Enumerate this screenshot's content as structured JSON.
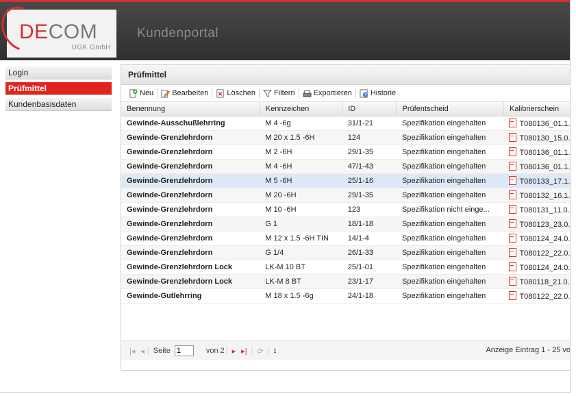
{
  "header": {
    "logo": {
      "brand_de": "DE",
      "brand_com": "COM",
      "sub": "UGK GmbH"
    },
    "title": "Kundenportal"
  },
  "sidebar": {
    "items": [
      {
        "label": "Login",
        "active": false
      },
      {
        "label": "Prüfmittel",
        "active": true
      },
      {
        "label": "Kundenbasisdaten",
        "active": false
      }
    ]
  },
  "panel": {
    "title": "Prüfmittel",
    "toolbar": {
      "new": "Neu",
      "edit": "Bearbeiten",
      "delete": "Löschen",
      "filter": "Filtern",
      "export": "Exportieren",
      "history": "Historie"
    },
    "columns": [
      "Benennung",
      "Kennzeichen",
      "ID",
      "Prüfentscheid",
      "Kalibrierschein"
    ],
    "rows": [
      {
        "name": "Gewinde-Ausschußlehrring",
        "mark": "M 4 -6g",
        "id": "31/1-21",
        "decision": "Spezifikation eingehalten",
        "cert": "T080136_01.1..."
      },
      {
        "name": "Gewinde-Grenzlehrdorn",
        "mark": "M 20 x 1.5 -6H",
        "id": "124",
        "decision": "Spezifikation eingehalten",
        "cert": "T080130_15.0..."
      },
      {
        "name": "Gewinde-Grenzlehrdorn",
        "mark": "M 2 -6H",
        "id": "29/1-35",
        "decision": "Spezifikation eingehalten",
        "cert": "T080136_01.1..."
      },
      {
        "name": "Gewinde-Grenzlehrdorn",
        "mark": "M 4 -6H",
        "id": "47/1-43",
        "decision": "Spezifikation eingehalten",
        "cert": "T080136_01.1..."
      },
      {
        "name": "Gewinde-Grenzlehrdorn",
        "mark": "M 5 -6H",
        "id": "25/1-16",
        "decision": "Spezifikation eingehalten",
        "cert": "T080133_17.1..."
      },
      {
        "name": "Gewinde-Grenzlehrdorn",
        "mark": "M 20 -6H",
        "id": "29/1-35",
        "decision": "Spezifikation eingehalten",
        "cert": "T080132_16.1..."
      },
      {
        "name": "Gewinde-Grenzlehrdorn",
        "mark": "M 10 -6H",
        "id": "123",
        "decision": "Spezifikation nicht einge...",
        "cert": "T080131_11.0..."
      },
      {
        "name": "Gewinde-Grenzlehrdorn",
        "mark": "G 1",
        "id": "18/1-18",
        "decision": "Spezifikation eingehalten",
        "cert": "T080123_23.0..."
      },
      {
        "name": "Gewinde-Grenzlehrdorn",
        "mark": "M 12 x 1.5 -6H TIN",
        "id": "14/1-4",
        "decision": "Spezifikation eingehalten",
        "cert": "T080124_24.0..."
      },
      {
        "name": "Gewinde-Grenzlehrdorn",
        "mark": "G 1/4",
        "id": "26/1-33",
        "decision": "Spezifikation eingehalten",
        "cert": "T080122_22.0..."
      },
      {
        "name": "Gewinde-Grenzlehrdorn Lock",
        "mark": "LK-M 10 BT",
        "id": "25/1-01",
        "decision": "Spezifikation eingehalten",
        "cert": "T080124_24.0..."
      },
      {
        "name": "Gewinde-Grenzlehrdorn Lock",
        "mark": "LK-M 8 BT",
        "id": "23/1-17",
        "decision": "Spezifikation eingehalten",
        "cert": "T080118_21.0..."
      },
      {
        "name": "Gewinde-Gutlehrring",
        "mark": "M 18 x 1.5 -6g",
        "id": "24/1-18",
        "decision": "Spezifikation eingehalten",
        "cert": "T080122_22.0..."
      }
    ],
    "selected_row": 4,
    "pager": {
      "page_label": "Seite",
      "page_value": "1",
      "of_label": "von 2",
      "count_text": "Anzeige Eintrag 1 - 25 vo"
    }
  }
}
